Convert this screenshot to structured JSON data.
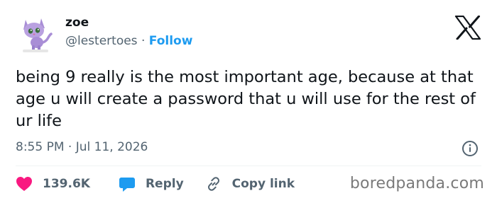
{
  "author": {
    "name": "zoe",
    "handle": "@lestertoes",
    "separator": "·",
    "follow_label": "Follow",
    "avatar_icon": "purple-cat-figurine-avatar"
  },
  "platform_icon": "x-logo-icon",
  "tweet": {
    "text": "being 9 really is the most important age, because at that age u will create a password that u will use for the rest of ur life",
    "timestamp": "8:55 PM · Jul 11, 2026"
  },
  "actions": {
    "like_count": "139.6K",
    "reply_label": "Reply",
    "copy_link_label": "Copy link"
  },
  "watermark": "boredpanda.com",
  "colors": {
    "text": "#0f1419",
    "secondary": "#536471",
    "follow_blue": "#1d9bf0",
    "like_pink": "#f91880",
    "reply_blue": "#1d9bf0"
  }
}
